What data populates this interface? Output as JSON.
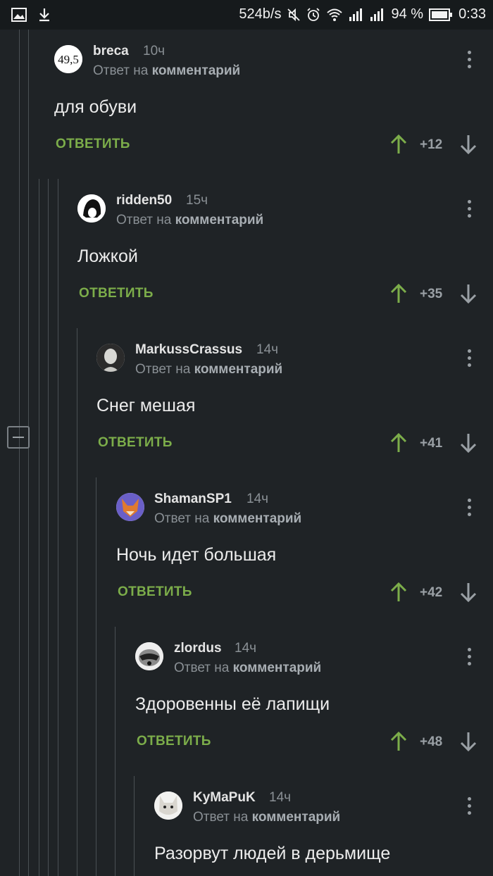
{
  "status_bar": {
    "speed": "524b/s",
    "battery": "94 %",
    "time": "0:33",
    "icons": [
      "image-icon",
      "download-icon",
      "mute-icon",
      "alarm-icon",
      "wifi-icon",
      "signal-icon",
      "signal-icon",
      "battery-icon"
    ]
  },
  "reply_to": {
    "prefix": "Ответ на",
    "target": "комментарий"
  },
  "reply_label": "ОТВЕТИТЬ",
  "comments": [
    {
      "username": "breca",
      "time": "10ч",
      "text": "для обуви",
      "score": "+12",
      "avatar_text": "49,5"
    },
    {
      "username": "ridden50",
      "time": "15ч",
      "text": "Ложкой",
      "score": "+35"
    },
    {
      "username": "MarkussCrassus",
      "time": "14ч",
      "text": "Снег мешая",
      "score": "+41"
    },
    {
      "username": "ShamanSP1",
      "time": "14ч",
      "text": "Ночь идет большая",
      "score": "+42"
    },
    {
      "username": "zlordus",
      "time": "14ч",
      "text": "Здоровенны её лапищи",
      "score": "+48"
    },
    {
      "username": "KyMaPuK",
      "time": "14ч",
      "text": "Разорвут людей в дерьмище"
    }
  ],
  "colors": {
    "background": "#1f2326",
    "accent_green": "#7cad4a",
    "muted": "#8a9095"
  }
}
